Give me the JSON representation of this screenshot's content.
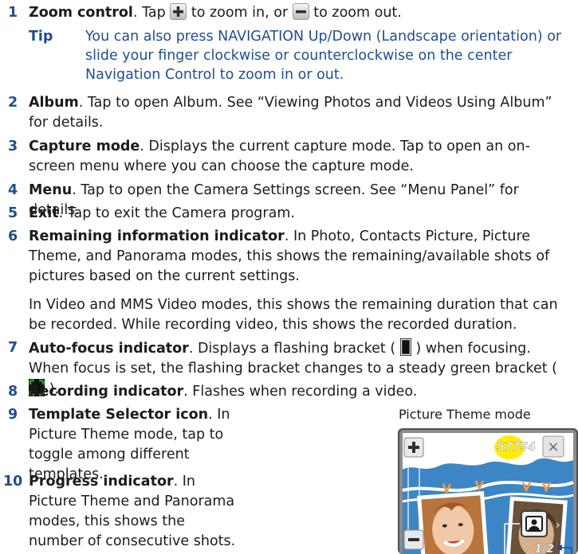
{
  "items": [
    {
      "num": "1",
      "title": "Zoom control",
      "pre": ". Tap ",
      "mid": " to zoom in, or ",
      "post": " to zoom out."
    },
    {
      "num": "2",
      "title": "Album",
      "text": ". Tap to open Album. See “Viewing Photos and Videos Using Album” for details."
    },
    {
      "num": "3",
      "title": "Capture mode",
      "text": ". Displays the current capture mode. Tap to open an on-screen menu where you can choose the capture mode."
    },
    {
      "num": "4",
      "title": "Menu",
      "text": ". Tap to open the Camera Settings screen. See “Menu Panel” for details."
    },
    {
      "num": "5",
      "title": "Exit",
      "text": ". Tap to exit the Camera program."
    },
    {
      "num": "6",
      "title": "Remaining information indicator",
      "text": ". In Photo, Contacts Picture, Picture Theme, and Panorama modes, this shows the remaining/available shots of pictures based on the current settings.",
      "text2": "In Video and MMS Video modes, this shows the remaining duration that can be recorded. While recording video, this shows the recorded duration."
    },
    {
      "num": "7",
      "title": "Auto-focus indicator",
      "pre": ". Displays a flashing bracket ( ",
      "mid": " ) when focusing. When focus is set, the flashing bracket changes to a steady green bracket ( ",
      "post": " )."
    },
    {
      "num": "8",
      "title": "Recording indicator",
      "text": ". Flashes when recording a video."
    },
    {
      "num": "9",
      "title": "Template Selector icon",
      "text": ". In Picture Theme mode, tap to toggle among different templates."
    },
    {
      "num": "10",
      "title": "Progress indicator",
      "text": ". In Picture Theme and Panorama modes, this shows the number of consecutive shots."
    }
  ],
  "tip": {
    "label": "Tip",
    "text": "You can also press NAVIGATION Up/Down (Landscape orientation) or slide your finger clockwise or counterclockwise on the center Navigation Control to zoom in or out."
  },
  "figure": {
    "caption": "Picture Theme mode",
    "counter": "57754",
    "progress": "1/2",
    "close_symbol": "×",
    "zoom_in_symbol": "+",
    "zoom_out_symbol": "−",
    "next_symbol": "›"
  },
  "colors": {
    "accent_blue": "#1f4f8f",
    "theme_blue": "#3d86c6",
    "focus_green": "#1e9a1e"
  }
}
